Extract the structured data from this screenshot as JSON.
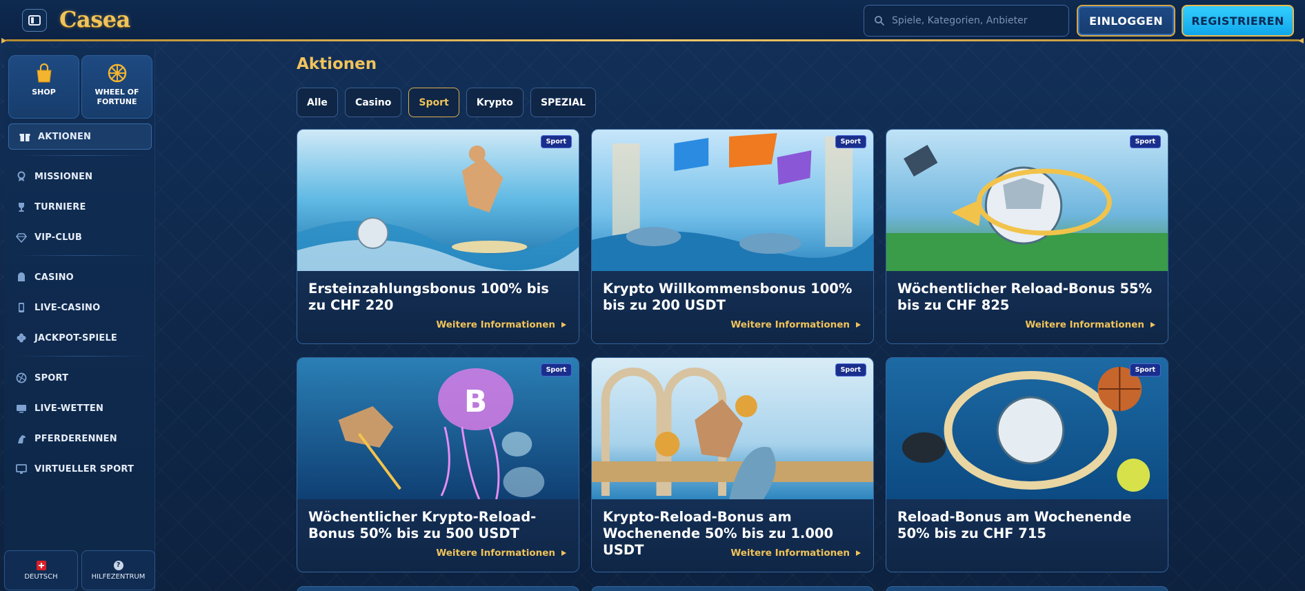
{
  "header": {
    "logo_text": "Casea",
    "search_placeholder": "Spiele, Kategorien, Anbieter",
    "login_label": "EINLOGGEN",
    "register_label": "REGISTRIEREN"
  },
  "sidebar": {
    "tiles": [
      {
        "label": "SHOP",
        "icon": "shopping-bag-icon"
      },
      {
        "label": "WHEEL OF FORTUNE",
        "label_line1": "WHEEL OF",
        "label_line2": "FORTUNE",
        "icon": "wheel-icon"
      }
    ],
    "active_item": {
      "label": "AKTIONEN",
      "icon": "gift-icon"
    },
    "items": [
      {
        "label": "MISSIONEN",
        "icon": "badge-icon"
      },
      {
        "label": "TURNIERE",
        "icon": "trophy-icon"
      },
      {
        "label": "VIP-CLUB",
        "icon": "diamond-icon"
      },
      {
        "label": "CASINO",
        "icon": "casino-icon"
      },
      {
        "label": "LIVE-CASINO",
        "icon": "phone-icon"
      },
      {
        "label": "JACKPOT-SPIELE",
        "icon": "clover-icon"
      },
      {
        "label": "SPORT",
        "icon": "ball-icon"
      },
      {
        "label": "LIVE-WETTEN",
        "icon": "monitor-icon"
      },
      {
        "label": "PFERDERENNEN",
        "icon": "horse-icon"
      },
      {
        "label": "VIRTUELLER SPORT",
        "icon": "screen-icon"
      }
    ],
    "language_label": "DEUTSCH",
    "help_label": "HILFEZENTRUM"
  },
  "main": {
    "title": "Aktionen",
    "filters": [
      {
        "label": "Alle",
        "active": false
      },
      {
        "label": "Casino",
        "active": false
      },
      {
        "label": "Sport",
        "active": true
      },
      {
        "label": "Krypto",
        "active": false
      },
      {
        "label": "SPEZIAL",
        "active": false
      }
    ],
    "more_label": "Weitere Informationen",
    "cards": [
      {
        "badge": "Sport",
        "title": "Ersteinzahlungsbonus 100% bis zu CHF 220"
      },
      {
        "badge": "Sport",
        "title": "Krypto Willkommensbonus 100% bis zu 200 USDT"
      },
      {
        "badge": "Sport",
        "title": "Wöchentlicher Reload-Bonus 55% bis zu CHF 825"
      },
      {
        "badge": "Sport",
        "title": "Wöchentlicher Krypto-Reload-Bonus 50% bis zu 500 USDT"
      },
      {
        "badge": "Sport",
        "title": "Krypto-Reload-Bonus am Wochenende 50% bis zu 1.000 USDT"
      },
      {
        "badge": "Sport",
        "title": "Reload-Bonus am Wochenende 50% bis zu CHF 715"
      }
    ]
  },
  "colors": {
    "accent_gold": "#f0c35a",
    "background": "#0f2748",
    "register_cyan": "#1fb8f5"
  }
}
